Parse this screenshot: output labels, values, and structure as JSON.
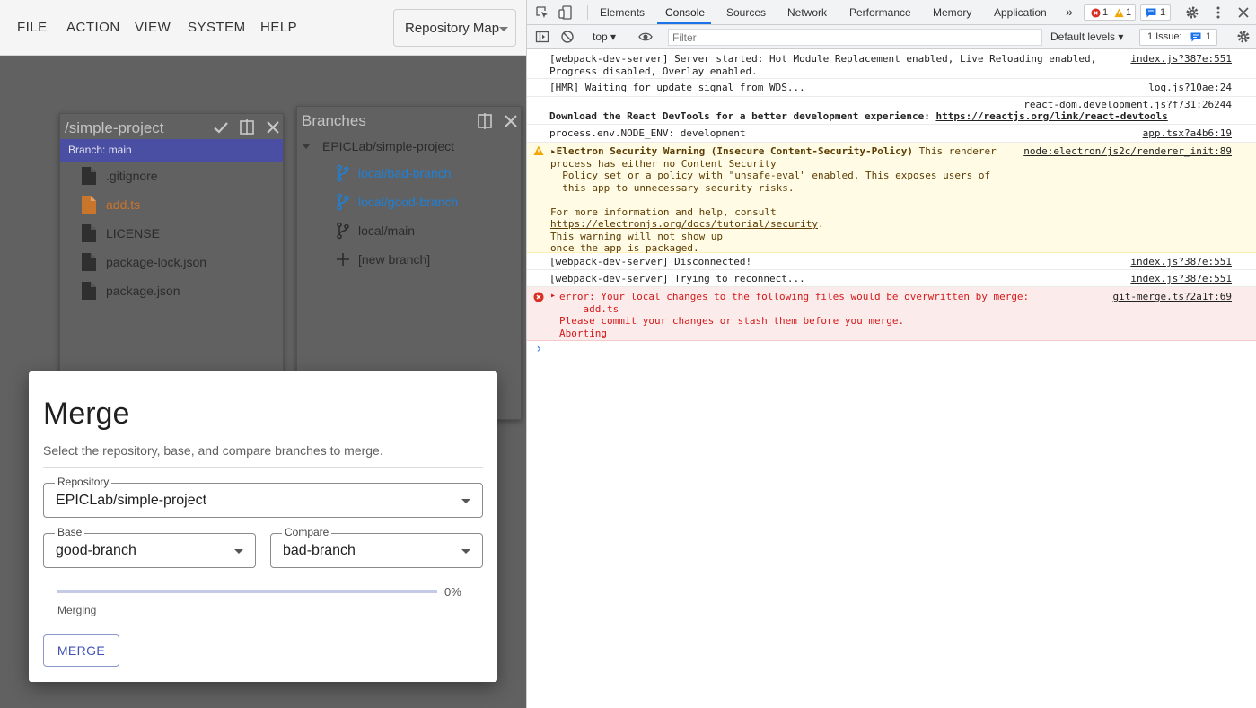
{
  "menu": {
    "items": [
      "FILE",
      "ACTION",
      "VIEW",
      "SYSTEM",
      "HELP"
    ],
    "map_select": "Repository Map"
  },
  "project_card": {
    "title": "/simple-project",
    "branch_label": "Branch: main",
    "files": [
      {
        "name": ".gitignore",
        "modified": false
      },
      {
        "name": "add.ts",
        "modified": true
      },
      {
        "name": "LICENSE",
        "modified": false
      },
      {
        "name": "package-lock.json",
        "modified": false
      },
      {
        "name": "package.json",
        "modified": false
      }
    ]
  },
  "branches_card": {
    "title": "Branches",
    "repo": "EPICLab/simple-project",
    "items": [
      "local/bad-branch",
      "local/good-branch",
      "local/main",
      "[new branch]"
    ]
  },
  "merge_dialog": {
    "title": "Merge",
    "description": "Select the repository, base, and compare branches to merge.",
    "repo_label": "Repository",
    "repo_value": "EPICLab/simple-project",
    "base_label": "Base",
    "base_value": "good-branch",
    "compare_label": "Compare",
    "compare_value": "bad-branch",
    "progress": 0,
    "progress_text": "0%",
    "status": "Merging",
    "button": "MERGE"
  },
  "devtools": {
    "tabs": [
      "Elements",
      "Console",
      "Sources",
      "Network",
      "Performance",
      "Memory",
      "Application"
    ],
    "active_tab": "Console",
    "more": "»",
    "error_count": "1",
    "warning_count": "1",
    "info_count": "1",
    "context": "top",
    "filter_placeholder": "Filter",
    "levels": "Default levels",
    "issues_label": "1 Issue:",
    "issues_count": "1",
    "messages": [
      {
        "text": "[webpack-dev-server] Server started: Hot Module Replacement enabled, Live Reloading enabled,\nProgress disabled, Overlay enabled.",
        "source": "index.js?387e:551"
      },
      {
        "text": "[HMR] Waiting for update signal from WDS...",
        "source": "log.js?10ae:24"
      },
      {
        "text_bold": "Download the React DevTools for a better development experience: ",
        "link": "https://reactjs.org/link/react-devtools",
        "source": "react-dom.development.js?f731:26244"
      },
      {
        "text": "process.env.NODE_ENV: development",
        "source": "app.tsx?a4b6:19"
      },
      {
        "title": "Electron Security Warning (Insecure Content-Security-Policy)",
        "text": " This renderer\nprocess has either no Content Security\n  Policy set or a policy with \"unsafe-eval\" enabled. This exposes users of\n  this app to unnecessary security risks.\n\nFor more information and help, consult",
        "link": "https://electronjs.org/docs/tutorial/security",
        "text_after": "This warning will not show up\nonce the app is packaged.",
        "source": "node:electron/js2c/renderer_init:89"
      },
      {
        "text": "[webpack-dev-server] Disconnected!",
        "source": "index.js?387e:551"
      },
      {
        "text": "[webpack-dev-server] Trying to reconnect...",
        "source": "index.js?387e:551"
      },
      {
        "text": "error: Your local changes to the following files would be overwritten by merge:\n    add.ts\nPlease commit your changes or stash them before you merge.\nAborting",
        "source": "git-merge.ts?2a1f:69"
      }
    ],
    "prompt": "›"
  },
  "colors": {
    "accent": "#3f51b5",
    "branch_bar": "#4b4fa3",
    "link_blue": "#1e80d8",
    "modified": "#c9752b",
    "error": "#d41a1a",
    "warning_bg": "#fffbe5"
  }
}
